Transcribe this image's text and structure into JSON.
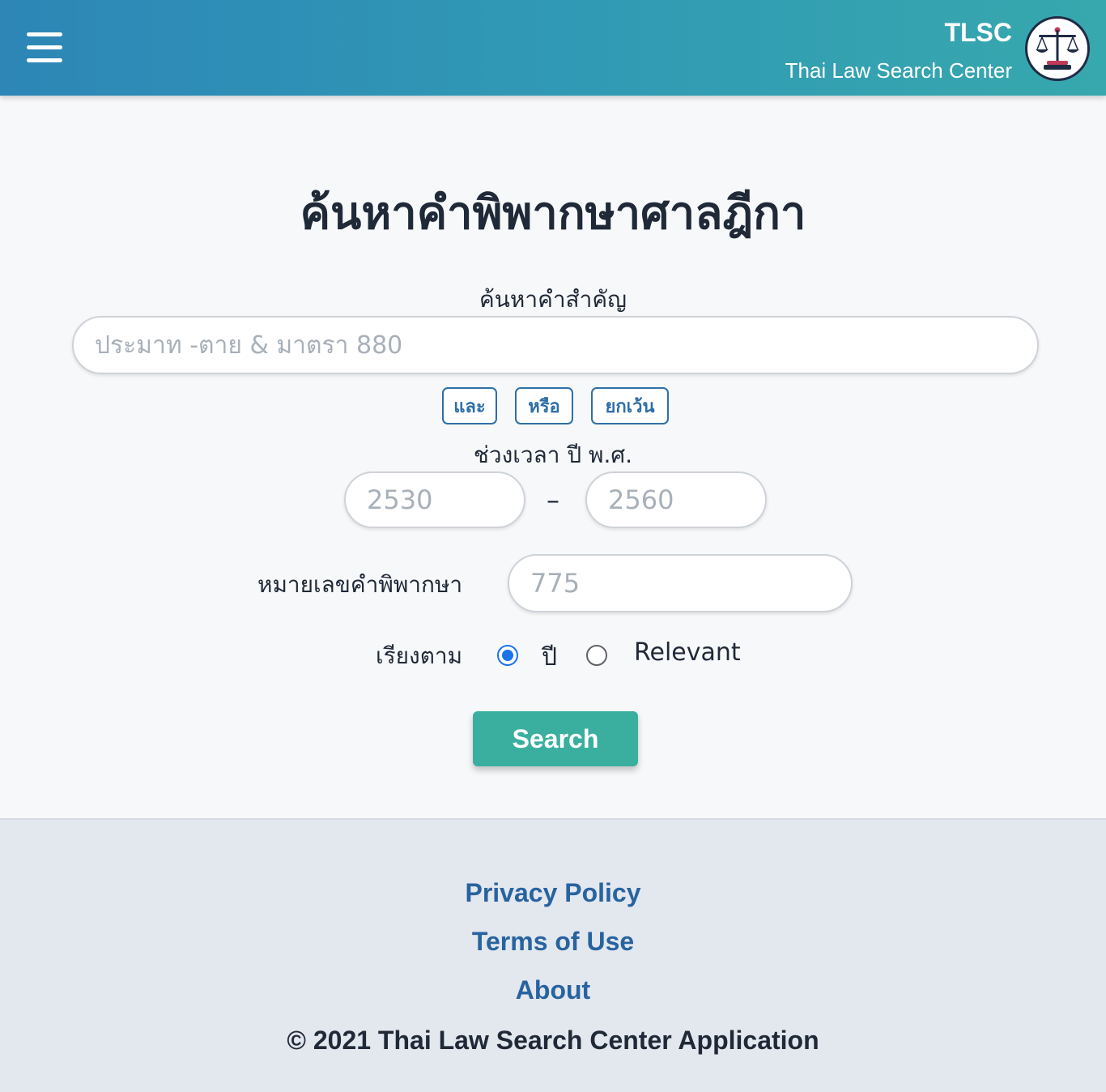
{
  "header": {
    "brand_short": "TLSC",
    "brand_long": "Thai Law Search Center",
    "menu_icon": "hamburger-icon",
    "logo_icon": "scales-of-justice-icon",
    "gradient": [
      "#2d86b6",
      "#37a8ad"
    ]
  },
  "main": {
    "title": "ค้นหาคำพิพากษาศาลฎีกา",
    "keyword_label": "ค้นหาคำสำคัญ",
    "keyword_placeholder": "ประมาท -ตาย & มาตรา 880",
    "operators": [
      "และ",
      "หรือ",
      "ยกเว้น"
    ],
    "range_label": "ช่วงเวลา ปี พ.ศ.",
    "year_from_placeholder": "2530",
    "year_to_placeholder": "2560",
    "range_separator": "–",
    "number_label": "หมายเลขคำพิพากษา",
    "number_placeholder": "775",
    "sort_label": "เรียงตาม",
    "sort_options": [
      "ปี",
      "Relevant"
    ],
    "sort_selected": "ปี",
    "search_button": "Search"
  },
  "footer": {
    "links": [
      "Privacy Policy",
      "Terms of Use",
      "About"
    ],
    "copyright": "© 2021 Thai Law Search Center Application"
  },
  "colors": {
    "accent": "#3aafa0",
    "link": "#2763a0",
    "operator": "#2e6fa8",
    "radio_checked": "#1a73e8"
  }
}
